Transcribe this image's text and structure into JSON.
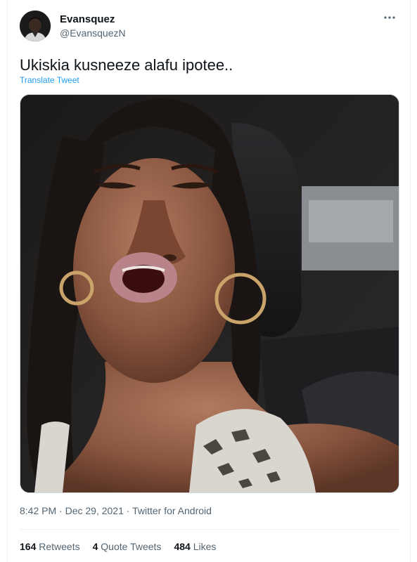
{
  "author": {
    "name": "Evansquez",
    "handle": "@EvansquezN"
  },
  "tweet": {
    "text": "Ukiskia kusneeze alafu ipotee..",
    "translate_label": "Translate Tweet",
    "time": "8:42 PM",
    "separator": "·",
    "date": "Dec 29, 2021",
    "source": "Twitter for Android"
  },
  "more_icon": "more-horizontal-icon",
  "stats": {
    "retweets_count": "164",
    "retweets_label": "Retweets",
    "quotes_count": "4",
    "quotes_label": "Quote Tweets",
    "likes_count": "484",
    "likes_label": "Likes"
  },
  "colors": {
    "accent": "#1d9bf0",
    "secondary_text": "#536471",
    "primary_text": "#0f1419",
    "border": "#eff3f4"
  }
}
